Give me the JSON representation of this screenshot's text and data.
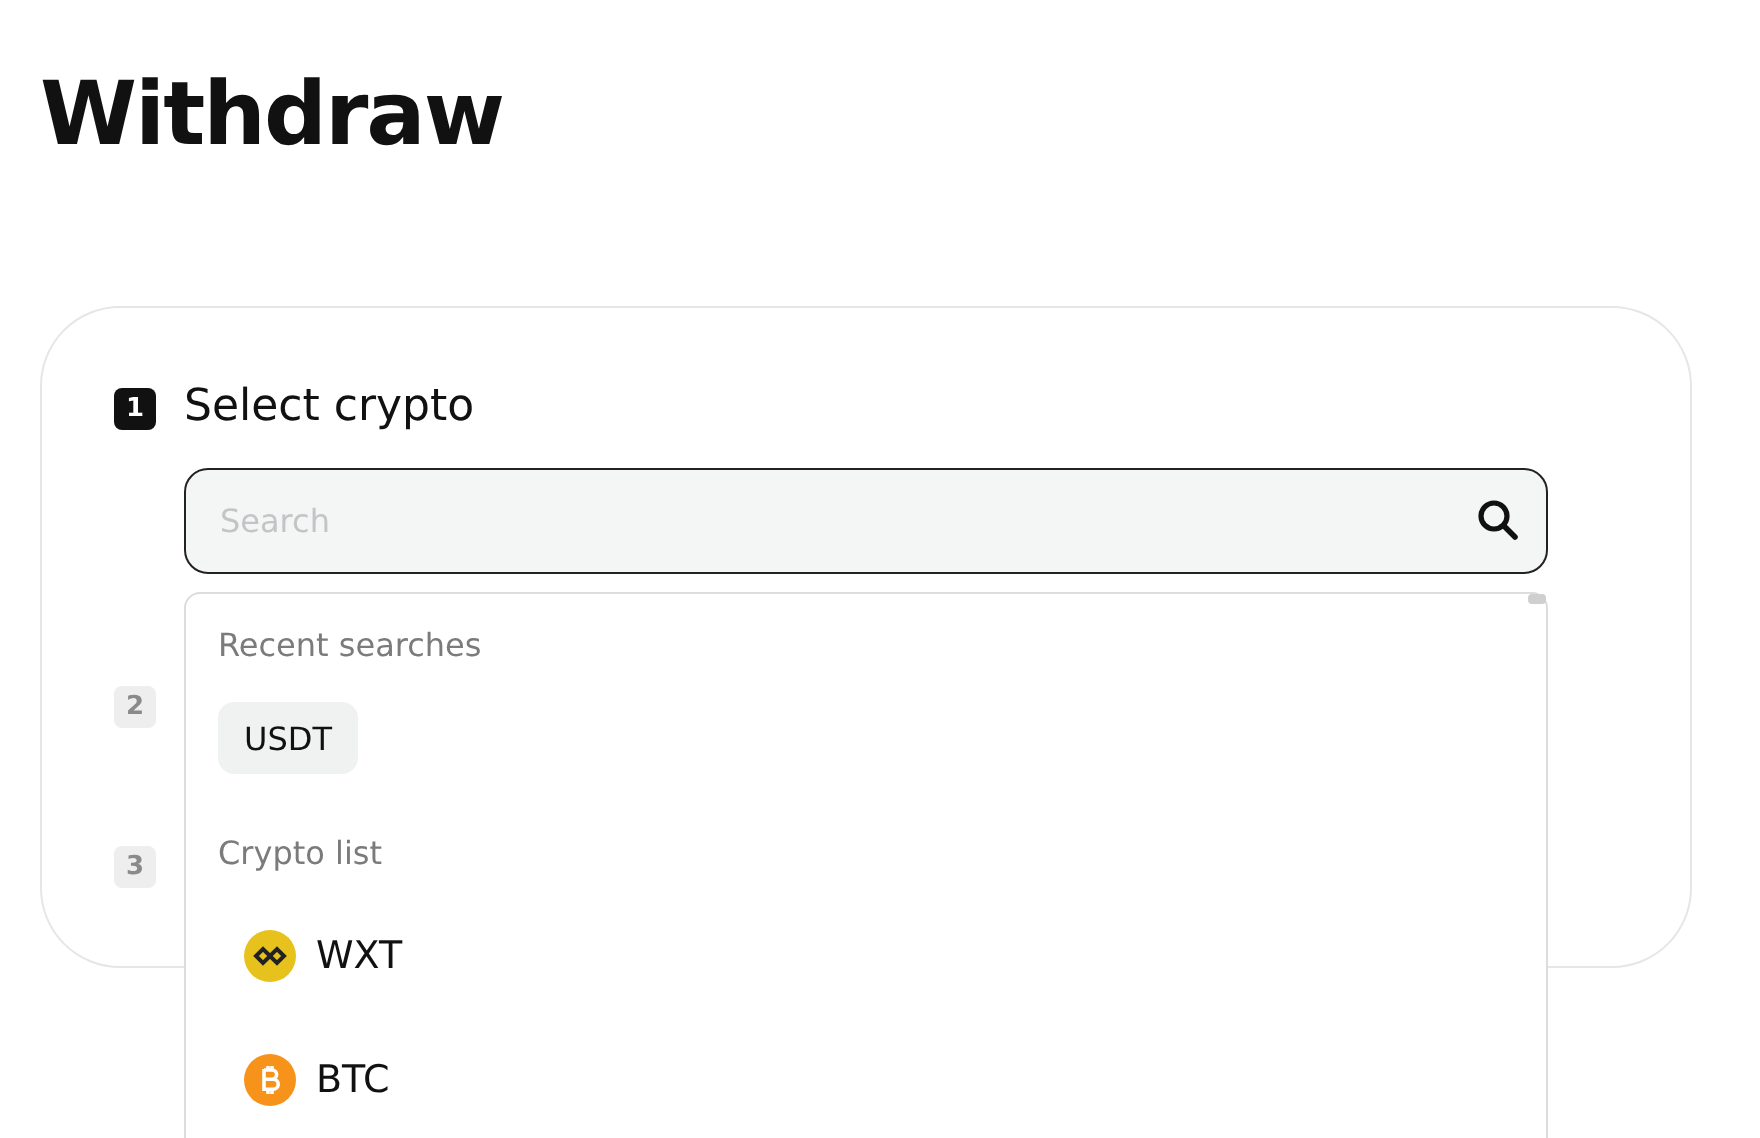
{
  "page_title": "Withdraw",
  "steps": [
    {
      "number": "1",
      "label": "Select crypto",
      "active": true
    },
    {
      "number": "2",
      "active": false
    },
    {
      "number": "3",
      "active": false
    }
  ],
  "search": {
    "placeholder": "Search"
  },
  "dropdown": {
    "recent_heading": "Recent searches",
    "recent": [
      "USDT"
    ],
    "list_heading": "Crypto list",
    "coins": [
      {
        "symbol": "WXT",
        "kind": "wxt"
      },
      {
        "symbol": "BTC",
        "kind": "btc"
      }
    ]
  }
}
